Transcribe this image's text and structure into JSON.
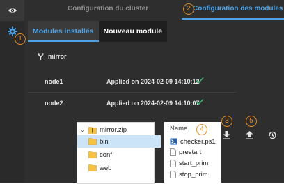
{
  "top_tabs": [
    {
      "label": "Configuration du cluster"
    },
    {
      "label": "Configuration des modules"
    }
  ],
  "sub_tabs": [
    {
      "label": "Modules installés"
    },
    {
      "label": "Nouveau module"
    }
  ],
  "module": {
    "name": "mirror",
    "icon": "fork-icon",
    "nodes": [
      {
        "name": "node1",
        "status": "Applied on 2024-02-09 14:10:12"
      },
      {
        "name": "node2",
        "status": "Applied on 2024-02-09 14:10:07"
      }
    ]
  },
  "callouts": [
    "1",
    "2",
    "3",
    "4",
    "5"
  ],
  "actions": [
    {
      "icon": "download-icon"
    },
    {
      "icon": "upload-icon"
    },
    {
      "icon": "history-icon"
    }
  ],
  "explorer": {
    "tree": [
      {
        "label": "mirror.zip",
        "icon": "zip-folder-icon"
      },
      {
        "label": "bin",
        "icon": "folder-icon",
        "selected": true
      },
      {
        "label": "conf",
        "icon": "folder-icon"
      },
      {
        "label": "web",
        "icon": "folder-icon"
      }
    ],
    "column_header": "Name",
    "files": [
      {
        "label": "checker.ps1",
        "icon": "powershell-icon"
      },
      {
        "label": "prestart",
        "icon": "file-icon"
      },
      {
        "label": "start_prim",
        "icon": "file-icon"
      },
      {
        "label": "stop_prim",
        "icon": "file-icon"
      }
    ]
  },
  "colors": {
    "accent": "#4fa3e6",
    "callout": "#e28a24",
    "success": "#3cb878",
    "background": "#2e2e2e"
  }
}
